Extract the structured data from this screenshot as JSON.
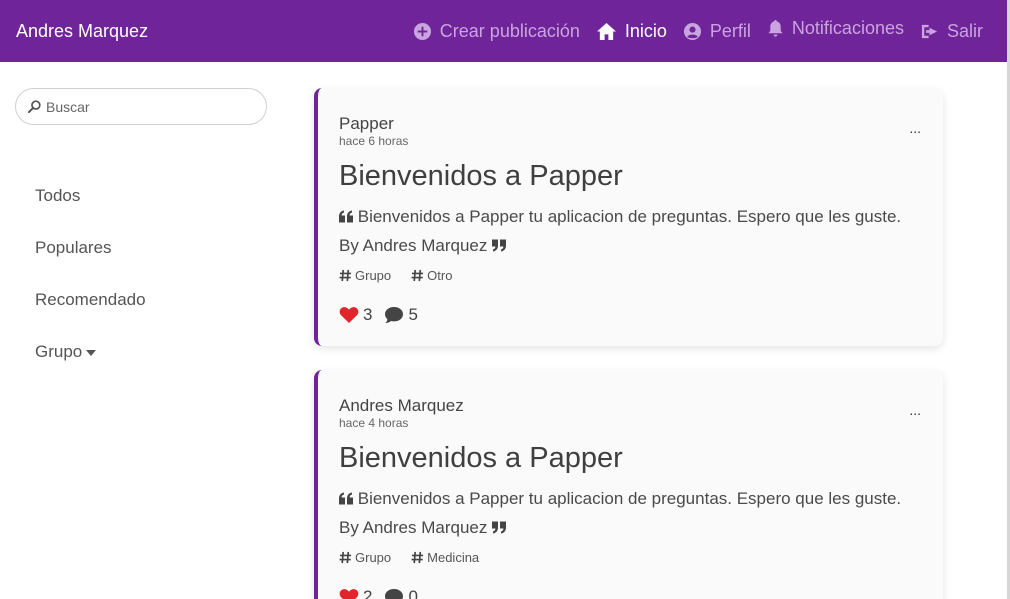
{
  "navbar": {
    "brand": "Andres Marquez",
    "items": [
      {
        "label": "Crear publicación",
        "icon": "plus-circle-icon"
      },
      {
        "label": "Inicio",
        "icon": "home-icon",
        "active": true
      },
      {
        "label": "Perfil",
        "icon": "user-circle-icon"
      },
      {
        "label": "Notificaciones",
        "icon": "bell-icon"
      },
      {
        "label": "Salir",
        "icon": "sign-out-icon"
      }
    ],
    "bg_color": "#6f2599",
    "inactive_color": "#c9a4df"
  },
  "sidebar": {
    "search_placeholder": "Buscar",
    "menu": [
      {
        "label": "Todos"
      },
      {
        "label": "Populares"
      },
      {
        "label": "Recomendado"
      },
      {
        "label": "Grupo",
        "has_dropdown": true
      }
    ]
  },
  "posts": [
    {
      "author": "Papper",
      "time": "hace 6 horas",
      "title": "Bienvenidos a Papper",
      "body": "Bienvenidos a Papper tu aplicacion de preguntas. Espero que les guste. By Andres Marquez",
      "tags": [
        "Grupo",
        "Otro"
      ],
      "likes": "3",
      "comments": "5",
      "more": "..."
    },
    {
      "author": "Andres Marquez",
      "time": "hace 4 horas",
      "title": "Bienvenidos a Papper",
      "body": "Bienvenidos a Papper tu aplicacion de preguntas. Espero que les guste. By Andres Marquez",
      "tags": [
        "Grupo",
        "Medicina"
      ],
      "likes": "2",
      "comments": "0",
      "more": "..."
    }
  ],
  "colors": {
    "accent": "#6f2599",
    "heart": "#e0262b",
    "comment": "#444444"
  }
}
